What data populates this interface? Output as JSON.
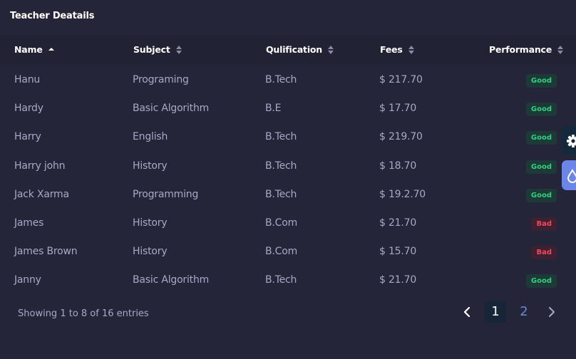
{
  "card": {
    "title": "Teacher Deatails"
  },
  "table": {
    "columns": [
      {
        "label": "Name",
        "sort": "asc"
      },
      {
        "label": "Subject",
        "sort": "none"
      },
      {
        "label": "Qulification",
        "sort": "none"
      },
      {
        "label": "Fees",
        "sort": "none"
      },
      {
        "label": "Performance",
        "sort": "none"
      }
    ],
    "rows": [
      {
        "name": "Hanu",
        "subject": "Programing",
        "qualification": "B.Tech",
        "fees": "$ 217.70",
        "performance": "Good"
      },
      {
        "name": "Hardy",
        "subject": "Basic Algorithm",
        "qualification": "B.E",
        "fees": "$ 17.70",
        "performance": "Good"
      },
      {
        "name": "Harry",
        "subject": "English",
        "qualification": "B.Tech",
        "fees": "$ 219.70",
        "performance": "Good"
      },
      {
        "name": "Harry john",
        "subject": "History",
        "qualification": "B.Tech",
        "fees": "$ 18.70",
        "performance": "Good"
      },
      {
        "name": "Jack Xarma",
        "subject": "Programming",
        "qualification": "B.Tech",
        "fees": "$ 19.2.70",
        "performance": "Good"
      },
      {
        "name": "James",
        "subject": "History",
        "qualification": "B.Com",
        "fees": "$ 21.70",
        "performance": "Bad"
      },
      {
        "name": "James Brown",
        "subject": "History",
        "qualification": "B.Com",
        "fees": "$ 15.70",
        "performance": "Bad"
      },
      {
        "name": "Janny",
        "subject": "Basic Algorithm",
        "qualification": "B.Tech",
        "fees": "$ 21.70",
        "performance": "Good"
      }
    ]
  },
  "footer": {
    "summary": "Showing 1 to 8 of 16 entries",
    "pages": [
      "1",
      "2"
    ],
    "current_page": "1",
    "prev_icon": "chevron-left-icon",
    "next_icon": "chevron-right-icon"
  },
  "side_tabs": [
    {
      "icon": "gear-icon"
    },
    {
      "icon": "droplet-icon"
    }
  ],
  "colors": {
    "background": "#25253a",
    "header_background": "#212334",
    "text_muted": "#a8a8c6",
    "good": "#2fd17d",
    "bad": "#f0475f",
    "accent": "#6b86e8"
  }
}
